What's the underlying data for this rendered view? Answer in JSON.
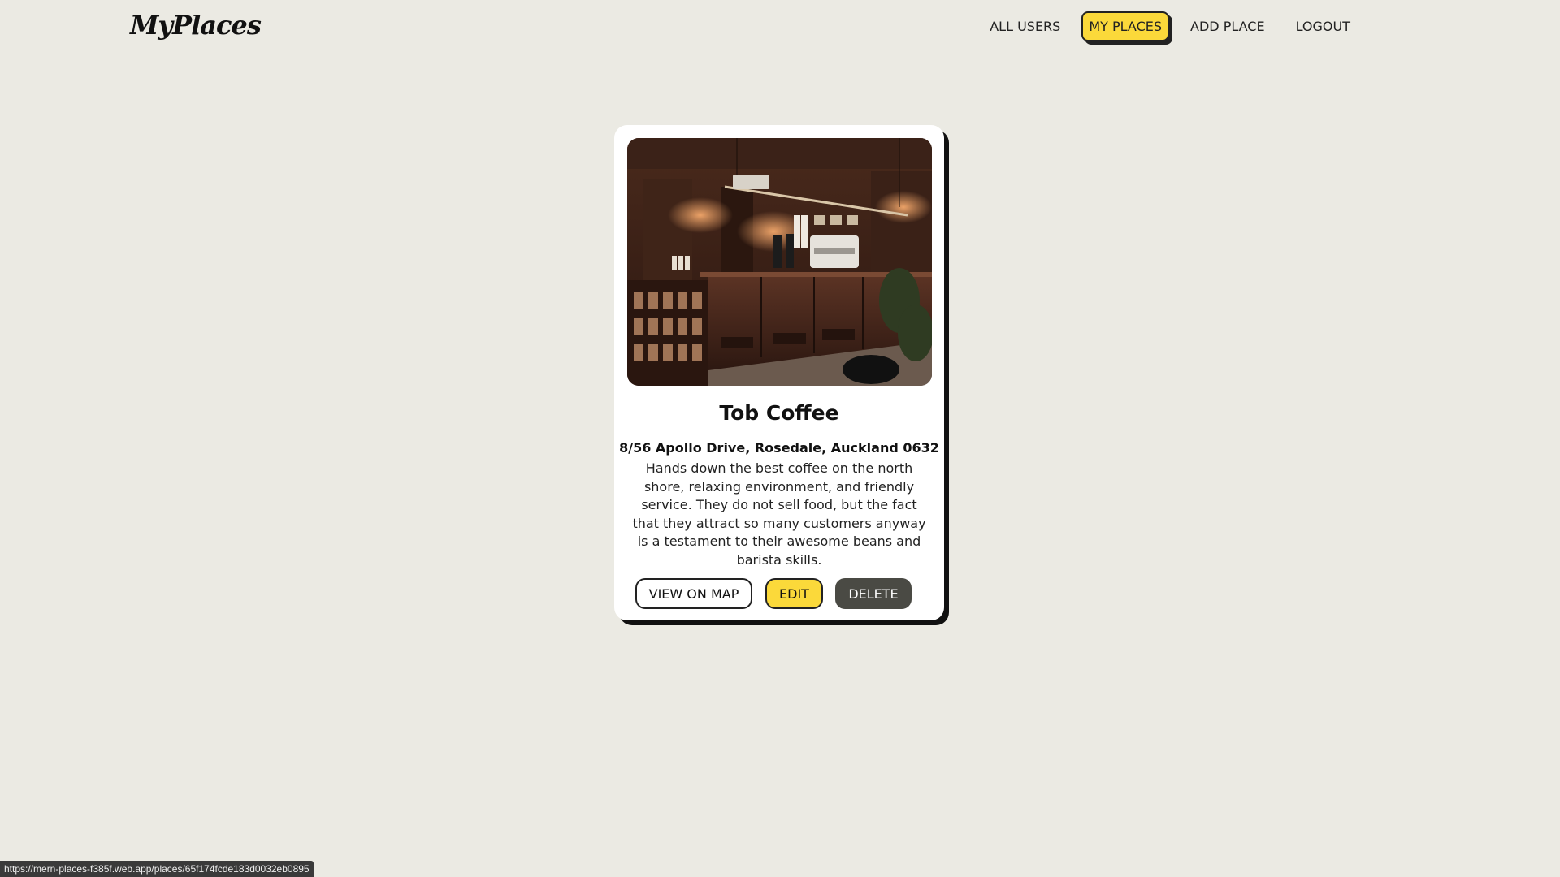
{
  "header": {
    "logo": "MyPlaces",
    "nav": [
      {
        "label": "ALL USERS",
        "active": false
      },
      {
        "label": "MY PLACES",
        "active": true
      },
      {
        "label": "ADD PLACE",
        "active": false
      },
      {
        "label": "LOGOUT",
        "active": false
      }
    ]
  },
  "place": {
    "title": "Tob Coffee",
    "address": "8/56 Apollo Drive, Rosedale, Auckland 0632",
    "description": "Hands down the best coffee on the north shore, relaxing environment, and friendly service. They do not sell food, but the fact that they attract so many customers anyway is a testament to their awesome beans and barista skills.",
    "actions": {
      "view_on_map": "VIEW ON MAP",
      "edit": "EDIT",
      "delete": "DELETE"
    }
  },
  "status_bar": {
    "url": "https://mern-places-f385f.web.app/places/65f174fcde183d0032eb0895"
  },
  "colors": {
    "background": "#ebeae3",
    "accent": "#fbd93a",
    "dark_button": "#4a4a44"
  }
}
